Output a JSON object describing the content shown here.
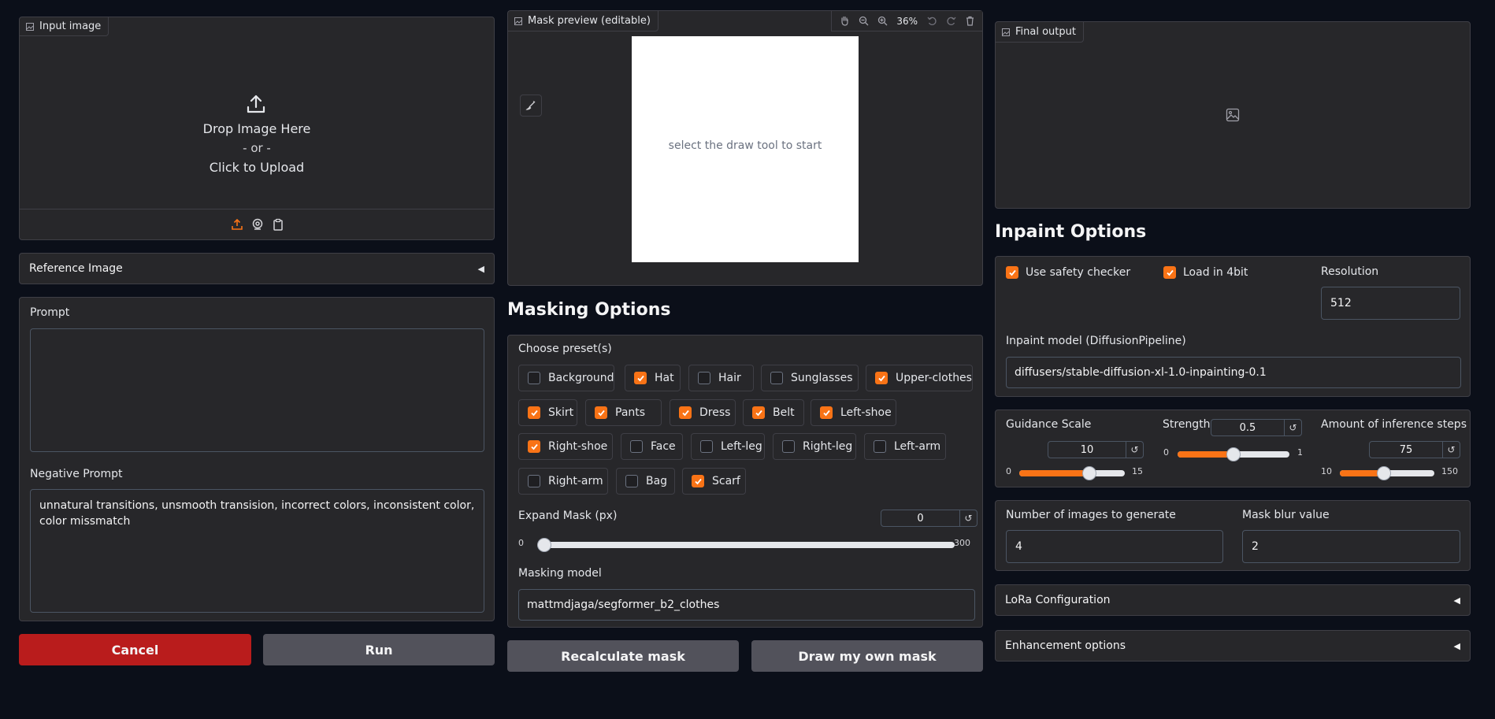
{
  "input_image": {
    "label": "Input image",
    "drop_text": "Drop Image Here",
    "or_text": "- or -",
    "click_text": "Click to Upload"
  },
  "reference_image": {
    "label": "Reference Image",
    "arrow": "◀"
  },
  "prompt": {
    "label": "Prompt",
    "value": ""
  },
  "negative_prompt": {
    "label": "Negative Prompt",
    "value": "unnatural transitions, unsmooth transision, incorrect colors, inconsistent color, color missmatch"
  },
  "buttons": {
    "cancel": "Cancel",
    "run": "Run",
    "recalculate": "Recalculate mask",
    "draw_own": "Draw my own mask"
  },
  "mask_preview": {
    "label": "Mask preview (editable)",
    "zoom": "36%",
    "canvas_hint": "select the draw tool to start"
  },
  "masking_options": {
    "title": "Masking Options",
    "presets_label": "Choose preset(s)",
    "presets": [
      {
        "label": "Background",
        "checked": false
      },
      {
        "label": "Hat",
        "checked": true
      },
      {
        "label": "Hair",
        "checked": false
      },
      {
        "label": "Sunglasses",
        "checked": false
      },
      {
        "label": "Upper-clothes",
        "checked": true
      },
      {
        "label": "Skirt",
        "checked": true
      },
      {
        "label": "Pants",
        "checked": true
      },
      {
        "label": "Dress",
        "checked": true
      },
      {
        "label": "Belt",
        "checked": true
      },
      {
        "label": "Left-shoe",
        "checked": true
      },
      {
        "label": "Right-shoe",
        "checked": true
      },
      {
        "label": "Face",
        "checked": false
      },
      {
        "label": "Left-leg",
        "checked": false
      },
      {
        "label": "Right-leg",
        "checked": false
      },
      {
        "label": "Left-arm",
        "checked": false
      },
      {
        "label": "Right-arm",
        "checked": false
      },
      {
        "label": "Bag",
        "checked": false
      },
      {
        "label": "Scarf",
        "checked": true
      }
    ],
    "expand_mask": {
      "label": "Expand Mask (px)",
      "value": "0",
      "min": "0",
      "max": "300",
      "fraction": 0
    },
    "masking_model": {
      "label": "Masking model",
      "value": "mattmdjaga/segformer_b2_clothes"
    }
  },
  "final_output": {
    "label": "Final output"
  },
  "inpaint_options": {
    "title": "Inpaint Options",
    "use_safety_checker": {
      "label": "Use safety checker",
      "checked": true
    },
    "load_4bit": {
      "label": "Load in 4bit",
      "checked": true
    },
    "resolution": {
      "label": "Resolution",
      "value": "512"
    },
    "inpaint_model": {
      "label": "Inpaint model (DiffusionPipeline)",
      "value": "diffusers/stable-diffusion-xl-1.0-inpainting-0.1"
    },
    "guidance_scale": {
      "label": "Guidance Scale",
      "value": "10",
      "min": "0",
      "max": "15",
      "fraction": 0.667
    },
    "strength": {
      "label": "Strength",
      "value": "0.5",
      "min": "0",
      "max": "1",
      "fraction": 0.5
    },
    "inference_steps": {
      "label": "Amount of inference steps",
      "value": "75",
      "min": "10",
      "max": "150",
      "fraction": 0.464
    },
    "num_images": {
      "label": "Number of images to generate",
      "value": "4"
    },
    "mask_blur": {
      "label": "Mask blur value",
      "value": "2"
    }
  },
  "lora_configuration": {
    "label": "LoRa Configuration",
    "arrow": "◀"
  },
  "enhancement_options": {
    "label": "Enhancement options",
    "arrow": "◀"
  },
  "colors": {
    "accent": "#f97316",
    "cancel": "#b91c1c",
    "background": "#0b0f19",
    "panel": "#27272a"
  }
}
